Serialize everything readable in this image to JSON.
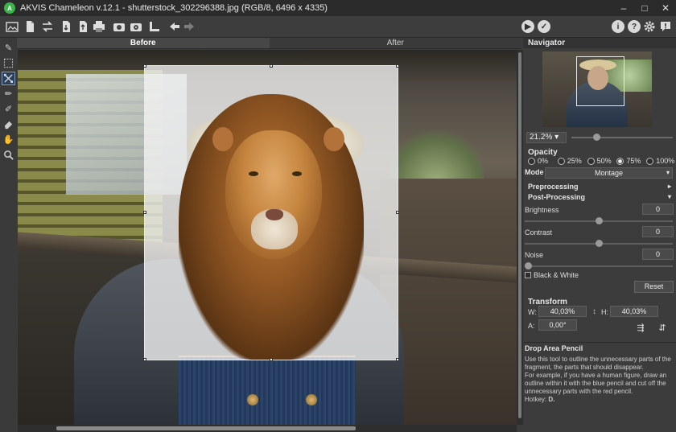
{
  "window": {
    "title": "AKVIS Chameleon v.12.1 - shutterstock_302296388.jpg (RGB/8, 6496 x 4335)",
    "controls": [
      "–",
      "□",
      "✕"
    ]
  },
  "toolbar": {
    "icons": [
      "open-icon",
      "new-icon",
      "swap-icon",
      "import-icon",
      "export-icon",
      "print-icon",
      "camera-icon",
      "camera2-icon",
      "ruler-icon",
      "undo-icon",
      "redo-icon"
    ],
    "right_icons": [
      "run-icon",
      "apply-icon",
      "info-icon",
      "help-icon",
      "settings-icon",
      "alert-icon"
    ]
  },
  "tabs": {
    "before": "Before",
    "after": "After",
    "active": "before"
  },
  "navigator": {
    "title": "Navigator",
    "zoom": "21.2%",
    "zoom_arrow": "▾"
  },
  "opacity": {
    "label": "Opacity",
    "options": [
      "0%",
      "25%",
      "50%",
      "75%",
      "100%"
    ],
    "selected": "75%"
  },
  "mode": {
    "label": "Mode",
    "value": "Montage",
    "arrow": "▾"
  },
  "preprocessing": {
    "label": "Preprocessing",
    "chevron": "▸"
  },
  "postprocessing": {
    "label": "Post-Processing",
    "chevron": "▾",
    "brightness": {
      "label": "Brightness",
      "value": "0"
    },
    "contrast": {
      "label": "Contrast",
      "value": "0"
    },
    "noise": {
      "label": "Noise",
      "value": "0"
    },
    "black_white": "Black & White",
    "reset": "Reset"
  },
  "transform": {
    "label": "Transform",
    "w_label": "W:",
    "w_value": "40,03%",
    "h_label": "H:",
    "h_value": "40,03%",
    "a_label": "A:",
    "a_value": "0,00°"
  },
  "help": {
    "title": "Drop Area Pencil",
    "text1": "Use this tool to outline the unnecessary parts of the fragment, the parts that should disappear.",
    "text2": "For example, if you have a human figure, draw an outline within it with the blue pencil and cut off the unnecessary parts with the red pencil.",
    "hotkey_label": "Hotkey: ",
    "hotkey": "D."
  },
  "colors": {
    "accent": "#3bb54a",
    "panel": "#3c3c3c",
    "titlebar": "#2b2b2b"
  }
}
